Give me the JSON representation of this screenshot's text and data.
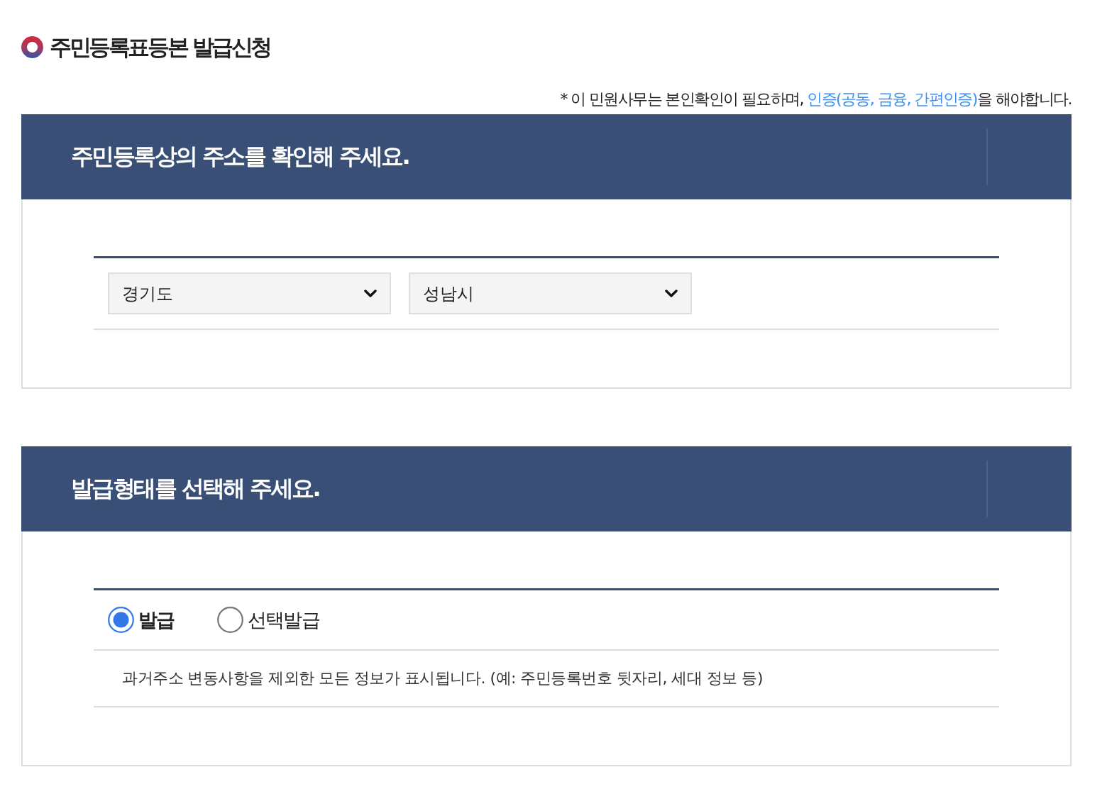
{
  "page": {
    "title": "주민등록표등본 발급신청"
  },
  "notice": {
    "before": "* 이 민원사무는 본인확인이 필요하며, ",
    "link": "인증(공동, 금융, 간편인증)",
    "after": "을 해야합니다."
  },
  "sections": [
    {
      "kind": "address",
      "title": "주민등록상의 주소를 확인해 주세요.",
      "selects": [
        {
          "value": "경기도"
        },
        {
          "value": "성남시"
        }
      ]
    },
    {
      "kind": "issue_type",
      "title": "발급형태를 선택해 주세요.",
      "options": [
        {
          "label": "발급",
          "selected": true
        },
        {
          "label": "선택발급",
          "selected": false
        }
      ],
      "description": "과거주소 변동사항을 제외한 모든 정보가 표시됩니다. (예: 주민등록번호 뒷자리, 세대 정보 등)"
    }
  ]
}
